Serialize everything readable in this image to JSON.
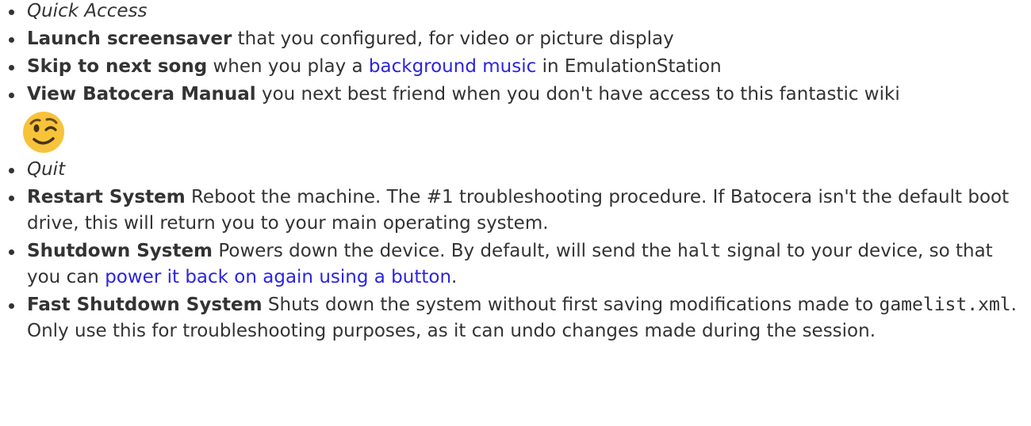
{
  "sections": {
    "quick_access": {
      "heading": "Quick Access",
      "items": {
        "screensaver": {
          "term": "Launch screensaver",
          "desc": " that you configured, for video or picture display"
        },
        "next_song": {
          "term": "Skip to next song",
          "desc_before": " when you play a ",
          "link": "background music",
          "desc_after": " in EmulationStation"
        },
        "manual": {
          "term": "View Batocera Manual",
          "desc": " you next best friend when you don't have access to this fantastic wiki"
        }
      },
      "emoji_icon": "winking-face-icon"
    },
    "quit": {
      "heading": "Quit",
      "items": {
        "restart": {
          "term": "Restart System",
          "desc": " Reboot the machine. The #1 troubleshooting procedure. If Batocera isn't the default boot drive, this will return you to your main operating system."
        },
        "shutdown": {
          "term": "Shutdown System",
          "desc_before": " Powers down the device. By default, will send the ",
          "code": "halt",
          "desc_mid": " signal to your device, so that you can ",
          "link": "power it back on again using a button",
          "desc_after": "."
        },
        "fast_shutdown": {
          "term": "Fast Shutdown System",
          "desc_before": " Shuts down the system without first saving modifications made to ",
          "code": "gamelist.xml",
          "desc_after": ". Only use this for troubleshooting purposes, as it can undo changes made during the session."
        }
      }
    }
  },
  "colors": {
    "text": "#333333",
    "link": "#2b24e0",
    "emoji": "#f7c33b"
  }
}
